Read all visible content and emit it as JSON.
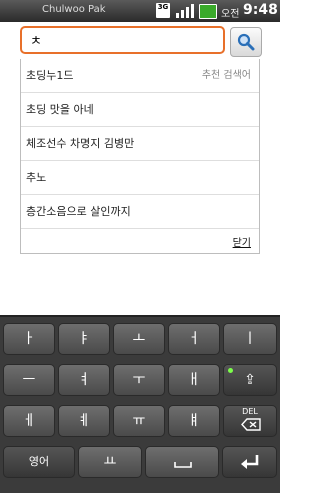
{
  "status_bar": {
    "carrier_label": "Chulwoo Pak",
    "network_badge": "3G",
    "am_pm": "오전",
    "time": "9:48"
  },
  "search": {
    "value": "ㅊ",
    "button_icon": "search-icon"
  },
  "suggestions": {
    "hint": "추천 검색어",
    "items": [
      "초딩누1드",
      "초딩 맛을 아네",
      "체조선수 차명지 김병만",
      "추노",
      "층간소음으로 살인까지"
    ],
    "close_label": "닫기"
  },
  "keyboard": {
    "rows": [
      [
        "ㅏ",
        "ㅑ",
        "ㅗ",
        "ㅓ",
        "ㅣ"
      ],
      [
        "ㅡ",
        "ㅕ",
        "ㅜ",
        "ㅐ",
        "⇪"
      ],
      [
        "ㅔ",
        "ㅖ",
        "ㅠ",
        "ㅒ",
        "DEL"
      ],
      [
        "영어",
        "ㅛ",
        "space",
        "enter"
      ]
    ],
    "mode_label": "영어",
    "del_label": "DEL"
  }
}
